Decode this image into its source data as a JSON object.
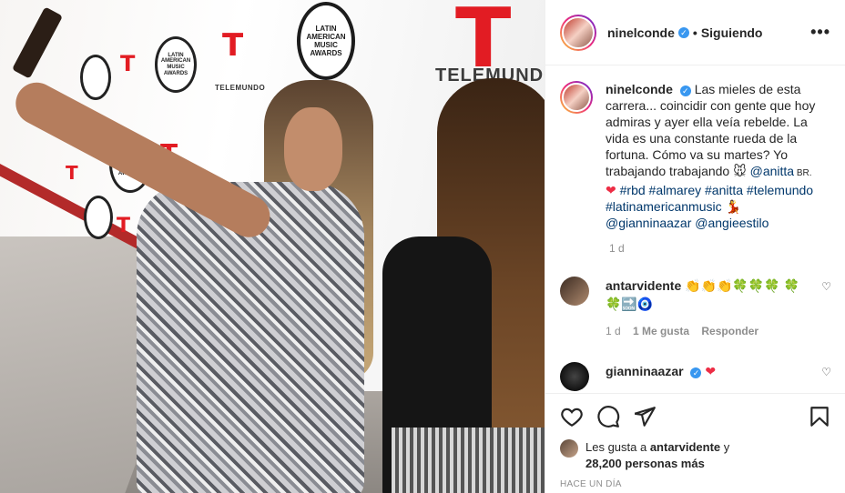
{
  "photo": {
    "backdrop_logo_text": "LATIN AMERICAN MUSIC AWARDS",
    "brand_text": "TELEMUNDO",
    "brand_mark": "T"
  },
  "header": {
    "username": "ninelconde",
    "separator": "•",
    "follow_label": "Siguiendo",
    "more_label": "•••"
  },
  "caption": {
    "username": "ninelconde",
    "text_1": "Las mieles de esta carrera... coincidir con gente que hoy admiras y ayer ella veía rebelde. La vida es una constante rueda de la fortuna. Cómo va su martes? Yo trabajando trabajando 🐭 ",
    "mention_anitta": "@anitta",
    "flag": " BR. ",
    "heart": "❤",
    "tags_1": " #rbd #almarey #anitta #telemundo #latinamericanmusic",
    "dancer": " 💃 ",
    "mentions_2": "@gianninaazar @angieestilo",
    "time": "1 d"
  },
  "comments": [
    {
      "username": "antarvidente",
      "text": "👏👏👏🍀🍀🍀 🍀🍀🔜🧿",
      "time": "1 d",
      "likes": "1 Me gusta",
      "reply": "Responder"
    },
    {
      "username": "gianninaazar",
      "text": "❤"
    }
  ],
  "likes": {
    "prefix": "Les gusta a ",
    "user": "antarvidente",
    "middle": " y ",
    "count": "28,200 personas más"
  },
  "timestamp": "HACE UN DÍA",
  "colors": {
    "accent_blue": "#3897f0",
    "tag_blue": "#00376b",
    "heart_red": "#ed2d45",
    "telemundo_red": "#e21c23"
  }
}
